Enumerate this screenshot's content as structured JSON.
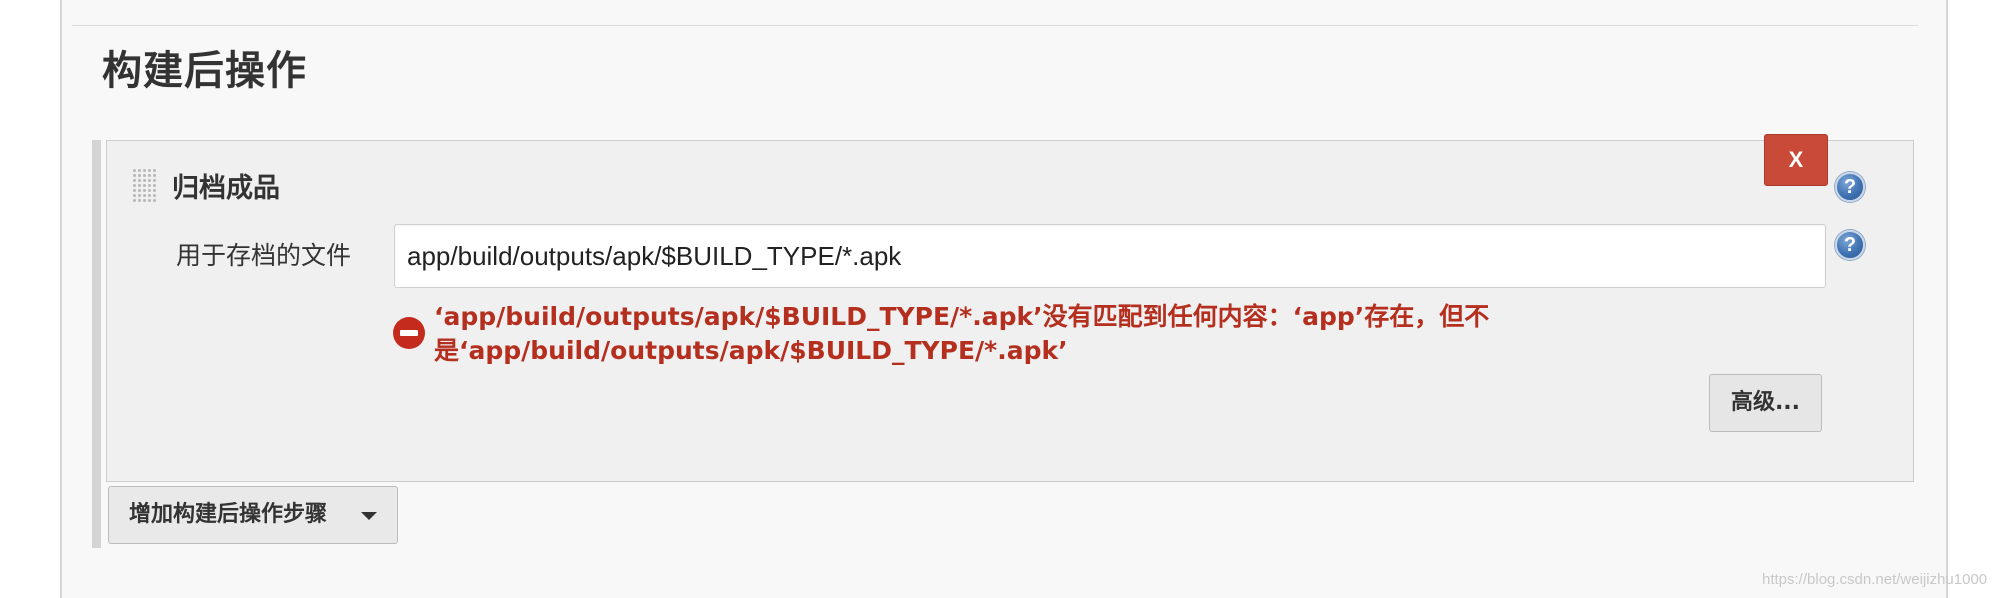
{
  "section": {
    "title": "构建后操作"
  },
  "step": {
    "title": "归档成品",
    "delete_label": "X",
    "help_label": "?",
    "field_label": "用于存档的文件",
    "field_value": "app/build/outputs/apk/$BUILD_TYPE/*.apk",
    "error_line1": "‘app/build/outputs/apk/$BUILD_TYPE/*.apk’没有匹配到任何内容：‘app’存在，但不",
    "error_line2": "是‘app/build/outputs/apk/$BUILD_TYPE/*.apk’",
    "advanced_label": "高级..."
  },
  "footer": {
    "add_step_label": "增加构建后操作步骤"
  },
  "watermark": "https://blog.csdn.net/weijizhu1000",
  "colors": {
    "error": "#b52f1f",
    "delete_button": "#c94a38",
    "help_icon": "#3f72b3"
  },
  "icons": {
    "drag": "drag-handle-icon",
    "help": "help-icon",
    "error": "error-icon",
    "dropdown": "caret-down-icon"
  }
}
